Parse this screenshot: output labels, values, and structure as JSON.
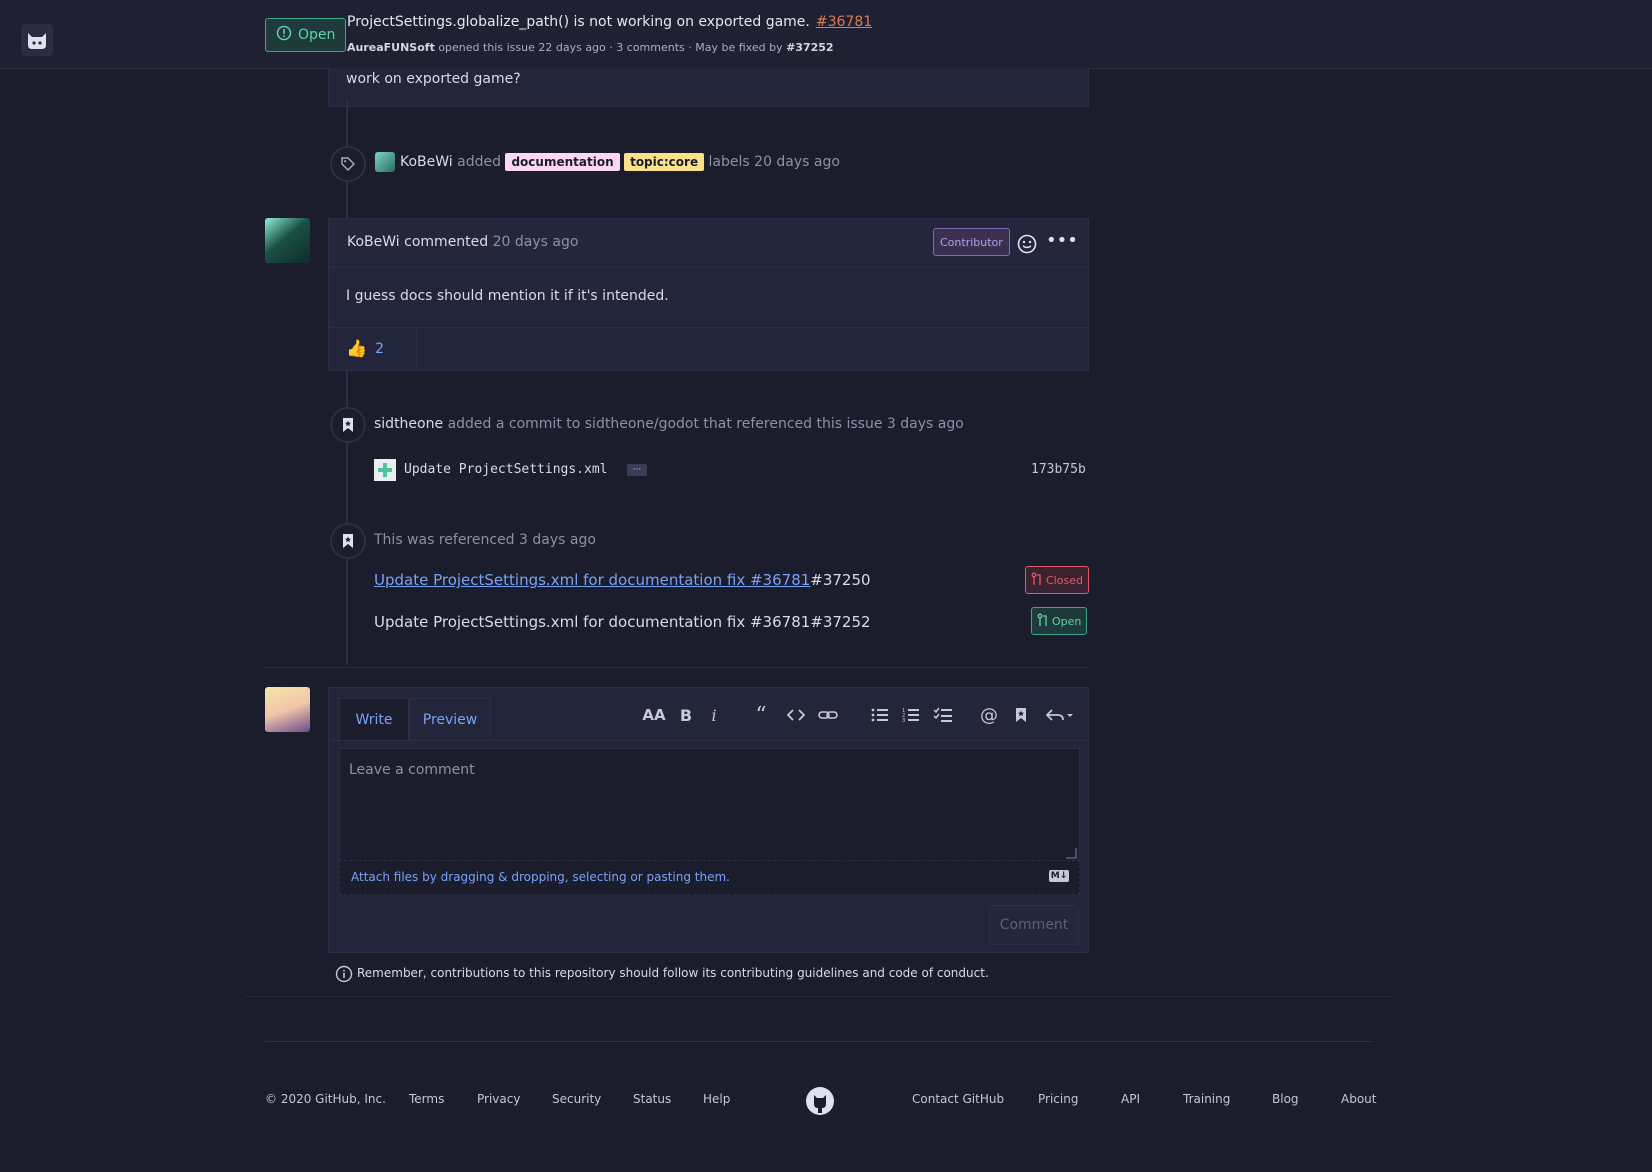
{
  "header": {
    "state": "Open",
    "title": "ProjectSettings.globalize_path() is not working on exported game.",
    "number": "#36781",
    "author": "AureaFUNSoft",
    "opened_text": "opened this issue",
    "opened_time": "22 days ago",
    "meta": "· 3 comments · May be fixed by",
    "fixed_by": "#37252"
  },
  "issue_body_tail": "work on exported game?",
  "label_event": {
    "user": "KoBeWi",
    "action": "added",
    "labels": [
      {
        "name": "documentation",
        "bg": "#fcd6f5",
        "fg": "#1b1c2c"
      },
      {
        "name": "topic:core",
        "bg": "#fbe28a",
        "fg": "#1b1c2c"
      }
    ],
    "suffix": "labels",
    "time": "20 days ago"
  },
  "comment": {
    "author": "KoBeWi",
    "verb": "commented",
    "time": "20 days ago",
    "role": "Contributor",
    "body": "I guess docs should mention it if it's intended.",
    "reaction_emoji": "👍",
    "reaction_count": "2"
  },
  "commit_event": {
    "user": "sidtheone",
    "text": "added a commit to sidtheone/godot that referenced this issue",
    "time": "3 days ago",
    "commit_msg": "Update ProjectSettings.xml",
    "ellipsis": "···",
    "sha": "173b75b"
  },
  "ref_event": {
    "text": "This was referenced",
    "time": "3 days ago",
    "items": [
      {
        "title": "Update ProjectSettings.xml for documentation fix #36781",
        "num": "#37250",
        "state": "Closed",
        "color": "#e05a6a",
        "bg": "#3a2230"
      },
      {
        "title": "Update ProjectSettings.xml for documentation fix #36781",
        "num": "#37252",
        "state": "Open",
        "color": "#5fd0b0",
        "bg": "#1e3a3a"
      }
    ]
  },
  "editor": {
    "tab_write": "Write",
    "tab_preview": "Preview",
    "placeholder": "Leave a comment",
    "attach": "Attach files by dragging & dropping, selecting or pasting them.",
    "md_badge": "M↓",
    "submit": "Comment",
    "guidelines": "Remember, contributions to this repository should follow its contributing guidelines and code of conduct."
  },
  "footer": {
    "copyright": "© 2020 GitHub, Inc.",
    "left_links": [
      "Terms",
      "Privacy",
      "Security",
      "Status",
      "Help"
    ],
    "right_links": [
      "Contact GitHub",
      "Pricing",
      "API",
      "Training",
      "Blog",
      "About"
    ]
  },
  "colors": {
    "background": "#1b1c2c",
    "surface": "#23253a",
    "accent_link": "#7aa2f7",
    "open_green": "#5fd0b0",
    "closed_red": "#e05a6a",
    "contributor_purple": "#b79cf0"
  }
}
